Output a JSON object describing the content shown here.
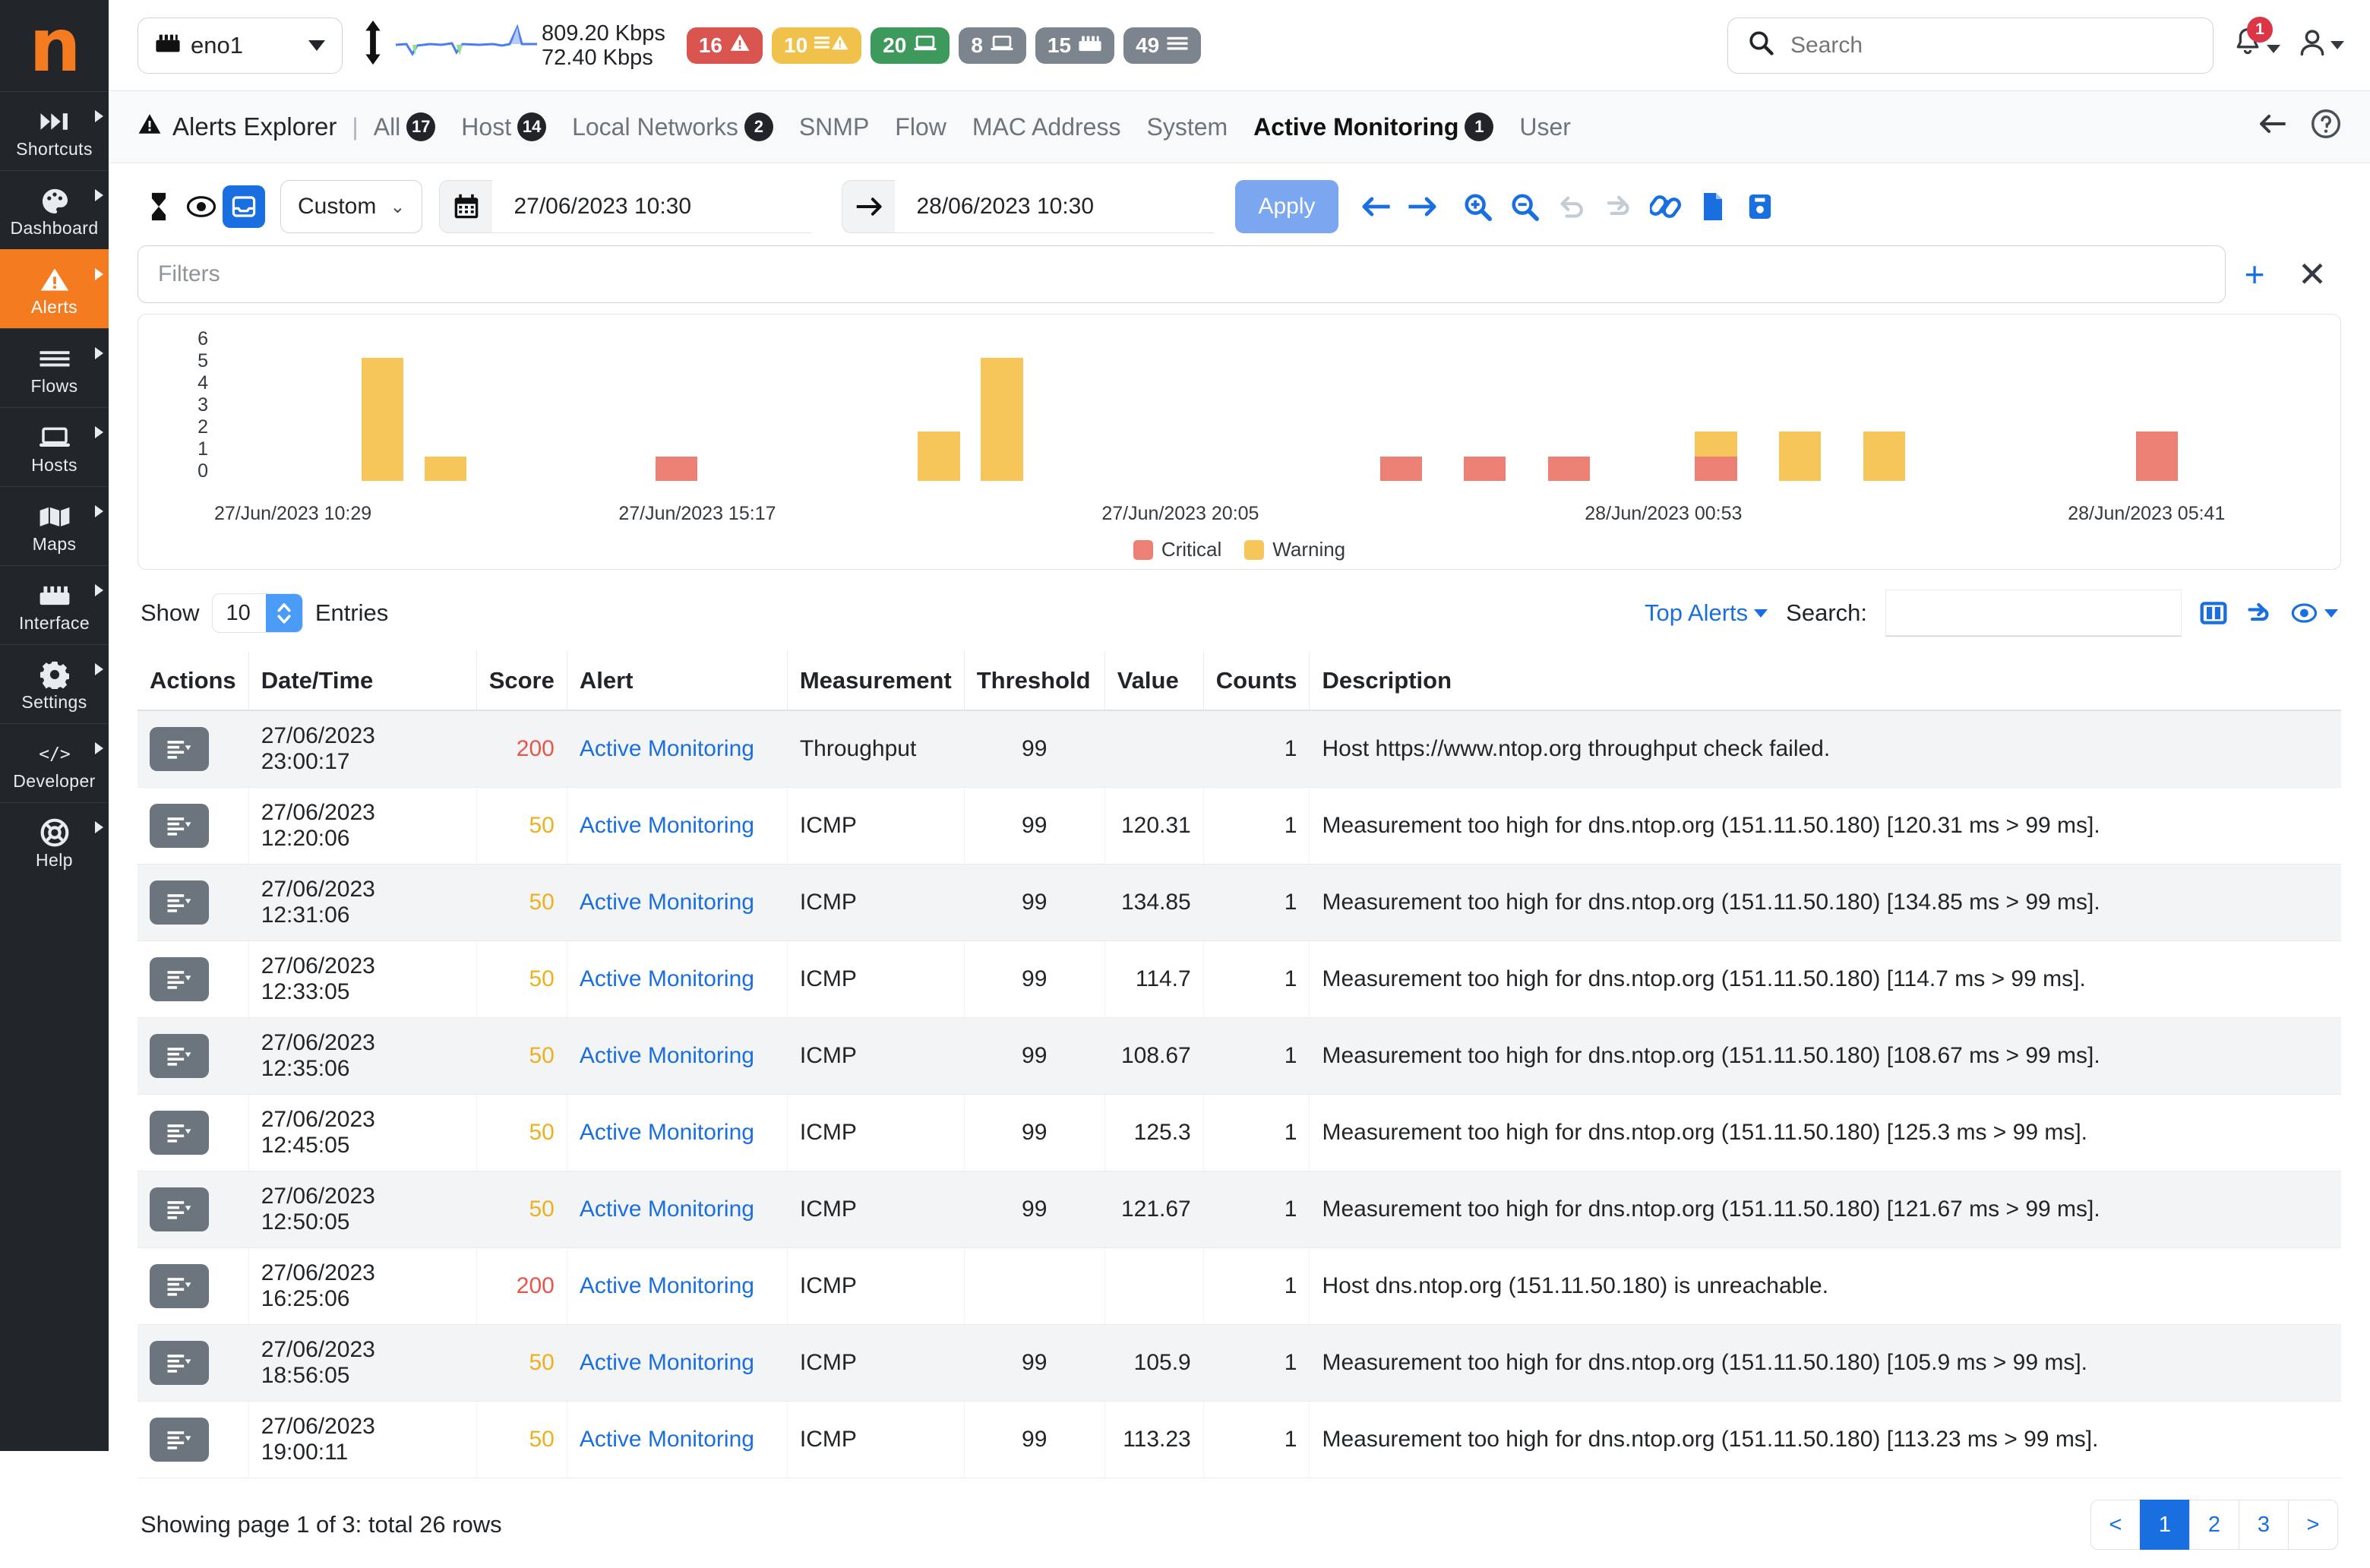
{
  "sidebar": {
    "logo": "n",
    "items": [
      {
        "label": "Shortcuts",
        "icon": "shortcuts-icon",
        "active": false
      },
      {
        "label": "Dashboard",
        "icon": "dashboard-icon",
        "active": false
      },
      {
        "label": "Alerts",
        "icon": "alerts-warning-icon",
        "active": true
      },
      {
        "label": "Flows",
        "icon": "flows-lines-icon",
        "active": false
      },
      {
        "label": "Hosts",
        "icon": "hosts-laptop-icon",
        "active": false
      },
      {
        "label": "Maps",
        "icon": "maps-icon",
        "active": false
      },
      {
        "label": "Interface",
        "icon": "interface-ethernet-icon",
        "active": false
      },
      {
        "label": "Settings",
        "icon": "gear-icon",
        "active": false
      },
      {
        "label": "Developer",
        "icon": "code-icon",
        "active": false
      },
      {
        "label": "Help",
        "icon": "help-lifering-icon",
        "active": false
      }
    ]
  },
  "topbar": {
    "interface": "eno1",
    "interface_icon": "ethernet-icon",
    "rate_down": "809.20 Kbps",
    "rate_up": "72.40 Kbps",
    "badges": [
      {
        "value": "16",
        "icon": "warning-triangle-icon",
        "color": "#d9534f",
        "style": "bg-danger"
      },
      {
        "value": "10",
        "icon": "list-warning-icon",
        "color": "#f0c14b",
        "style": "bg-warn"
      },
      {
        "value": "20",
        "icon": "laptop-icon",
        "color": "#3d9a5c",
        "style": "bg-success"
      },
      {
        "value": "8",
        "icon": "laptop-icon",
        "color": "#7c848d",
        "style": "bg-grey"
      },
      {
        "value": "15",
        "icon": "ethernet-icon",
        "color": "#7c848d",
        "style": "bg-grey"
      },
      {
        "value": "49",
        "icon": "list-icon",
        "color": "#7c848d",
        "style": "bg-grey"
      }
    ],
    "search_placeholder": "Search",
    "notification_count": "1"
  },
  "tabbar": {
    "title": "Alerts Explorer",
    "separator": "|",
    "tabs": [
      {
        "label": "All",
        "badge": "17",
        "active": false
      },
      {
        "label": "Host",
        "badge": "14",
        "active": false
      },
      {
        "label": "Local Networks",
        "badge": "2",
        "active": false
      },
      {
        "label": "SNMP",
        "badge": "",
        "active": false
      },
      {
        "label": "Flow",
        "badge": "",
        "active": false
      },
      {
        "label": "MAC Address",
        "badge": "",
        "active": false
      },
      {
        "label": "System",
        "badge": "",
        "active": false
      },
      {
        "label": "Active Monitoring",
        "badge": "1",
        "active": true
      },
      {
        "label": "User",
        "badge": "",
        "active": false
      }
    ]
  },
  "toolbar": {
    "preset": "Custom",
    "date_from": "27/06/2023 10:30",
    "date_to": "28/06/2023 10:30",
    "apply_label": "Apply"
  },
  "filters": {
    "placeholder": "Filters"
  },
  "chart_data": {
    "type": "bar",
    "title": "",
    "xlabel": "",
    "ylabel": "",
    "ylim": [
      0,
      6
    ],
    "yticks": [
      "6",
      "5",
      "4",
      "3",
      "2",
      "1",
      "0"
    ],
    "grid": false,
    "stacked": true,
    "legend_position": "bottom",
    "legend": [
      {
        "name": "Critical",
        "color": "#ec8075"
      },
      {
        "name": "Warning",
        "color": "#f7c65a"
      }
    ],
    "xtick_labels": [
      "27/Jun/2023 10:29",
      "27/Jun/2023 15:17",
      "27/Jun/2023 20:05",
      "28/Jun/2023 00:53",
      "28/Jun/2023 05:41"
    ],
    "xtick_positions_pct": [
      1,
      23,
      46,
      69,
      92
    ],
    "bars": [
      {
        "pos_pct": 7.0,
        "critical": 0,
        "warning": 5
      },
      {
        "pos_pct": 10.0,
        "critical": 0,
        "warning": 1
      },
      {
        "pos_pct": 21.0,
        "critical": 1,
        "warning": 0
      },
      {
        "pos_pct": 33.5,
        "critical": 0,
        "warning": 2
      },
      {
        "pos_pct": 36.5,
        "critical": 0,
        "warning": 5
      },
      {
        "pos_pct": 55.5,
        "critical": 1,
        "warning": 0
      },
      {
        "pos_pct": 59.5,
        "critical": 1,
        "warning": 0
      },
      {
        "pos_pct": 63.5,
        "critical": 1,
        "warning": 0
      },
      {
        "pos_pct": 70.5,
        "critical": 1,
        "warning": 1
      },
      {
        "pos_pct": 74.5,
        "critical": 0,
        "warning": 2
      },
      {
        "pos_pct": 78.5,
        "critical": 0,
        "warning": 2
      },
      {
        "pos_pct": 91.5,
        "critical": 2,
        "warning": 0
      }
    ]
  },
  "table_controls": {
    "show_label": "Show",
    "entries_value": "10",
    "entries_label": "Entries",
    "top_alerts_label": "Top Alerts",
    "search_label": "Search:",
    "search_value": ""
  },
  "table": {
    "columns": [
      "Actions",
      "Date/Time",
      "Score",
      "Alert",
      "Measurement",
      "Threshold",
      "Value",
      "Counts",
      "Description"
    ],
    "rows": [
      {
        "datetime": "27/06/2023 23:00:17",
        "score": "200",
        "score_level": "critical",
        "alert": "Active Monitoring",
        "measurement": "Throughput",
        "threshold": "99",
        "value": "",
        "counts": "1",
        "description": "Host https://www.ntop.org throughput check failed."
      },
      {
        "datetime": "27/06/2023 12:20:06",
        "score": "50",
        "score_level": "warning",
        "alert": "Active Monitoring",
        "measurement": "ICMP",
        "threshold": "99",
        "value": "120.31",
        "counts": "1",
        "description": "Measurement too high for dns.ntop.org (151.11.50.180) [120.31 ms > 99 ms]."
      },
      {
        "datetime": "27/06/2023 12:31:06",
        "score": "50",
        "score_level": "warning",
        "alert": "Active Monitoring",
        "measurement": "ICMP",
        "threshold": "99",
        "value": "134.85",
        "counts": "1",
        "description": "Measurement too high for dns.ntop.org (151.11.50.180) [134.85 ms > 99 ms]."
      },
      {
        "datetime": "27/06/2023 12:33:05",
        "score": "50",
        "score_level": "warning",
        "alert": "Active Monitoring",
        "measurement": "ICMP",
        "threshold": "99",
        "value": "114.7",
        "counts": "1",
        "description": "Measurement too high for dns.ntop.org (151.11.50.180) [114.7 ms > 99 ms]."
      },
      {
        "datetime": "27/06/2023 12:35:06",
        "score": "50",
        "score_level": "warning",
        "alert": "Active Monitoring",
        "measurement": "ICMP",
        "threshold": "99",
        "value": "108.67",
        "counts": "1",
        "description": "Measurement too high for dns.ntop.org (151.11.50.180) [108.67 ms > 99 ms]."
      },
      {
        "datetime": "27/06/2023 12:45:05",
        "score": "50",
        "score_level": "warning",
        "alert": "Active Monitoring",
        "measurement": "ICMP",
        "threshold": "99",
        "value": "125.3",
        "counts": "1",
        "description": "Measurement too high for dns.ntop.org (151.11.50.180) [125.3 ms > 99 ms]."
      },
      {
        "datetime": "27/06/2023 12:50:05",
        "score": "50",
        "score_level": "warning",
        "alert": "Active Monitoring",
        "measurement": "ICMP",
        "threshold": "99",
        "value": "121.67",
        "counts": "1",
        "description": "Measurement too high for dns.ntop.org (151.11.50.180) [121.67 ms > 99 ms]."
      },
      {
        "datetime": "27/06/2023 16:25:06",
        "score": "200",
        "score_level": "critical",
        "alert": "Active Monitoring",
        "measurement": "ICMP",
        "threshold": "",
        "value": "",
        "counts": "1",
        "description": "Host dns.ntop.org (151.11.50.180) is unreachable."
      },
      {
        "datetime": "27/06/2023 18:56:05",
        "score": "50",
        "score_level": "warning",
        "alert": "Active Monitoring",
        "measurement": "ICMP",
        "threshold": "99",
        "value": "105.9",
        "counts": "1",
        "description": "Measurement too high for dns.ntop.org (151.11.50.180) [105.9 ms > 99 ms]."
      },
      {
        "datetime": "27/06/2023 19:00:11",
        "score": "50",
        "score_level": "warning",
        "alert": "Active Monitoring",
        "measurement": "ICMP",
        "threshold": "99",
        "value": "113.23",
        "counts": "1",
        "description": "Measurement too high for dns.ntop.org (151.11.50.180) [113.23 ms > 99 ms]."
      }
    ]
  },
  "footer": {
    "status": "Showing page 1 of 3: total 26 rows",
    "pages": [
      "<",
      "1",
      "2",
      "3",
      ">"
    ],
    "active_page": "1"
  },
  "colors": {
    "brand_orange": "#f47b20",
    "link_blue": "#1a6fe0",
    "critical": "#ec8075",
    "warning": "#f7c65a",
    "score_critical": "#e8564a",
    "score_warning": "#efb01f"
  }
}
